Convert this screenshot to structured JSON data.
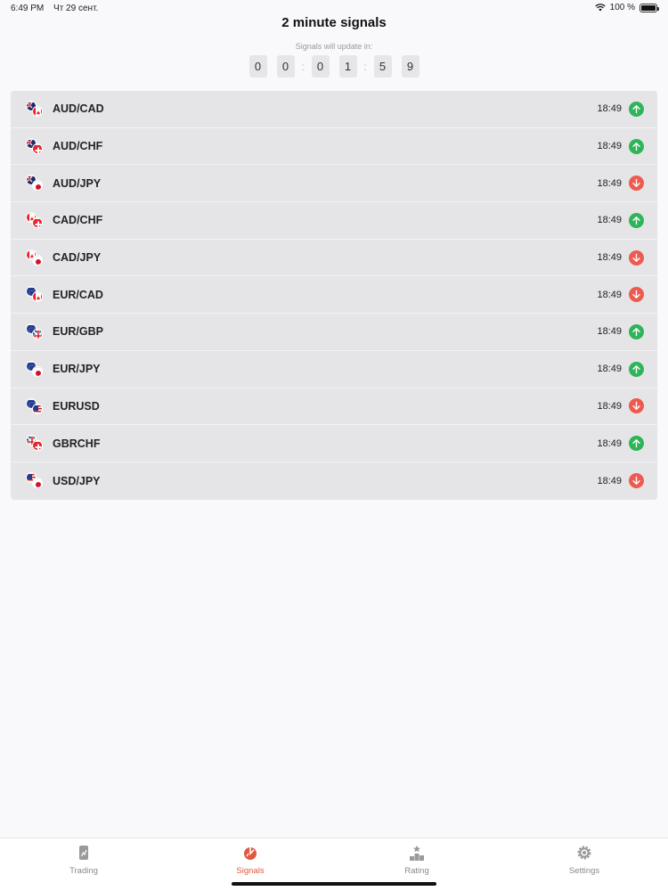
{
  "status_bar": {
    "time": "6:49 PM",
    "date": "Чт 29 сент.",
    "battery": "100 %"
  },
  "header": {
    "title": "2 minute signals",
    "countdown_label": "Signals will update in:",
    "countdown_digits": [
      "0",
      "0",
      "0",
      "1",
      "5",
      "9"
    ]
  },
  "signals": [
    {
      "pair": "AUD/CAD",
      "time": "18:49",
      "direction": "up",
      "flags": [
        "au",
        "ca"
      ]
    },
    {
      "pair": "AUD/CHF",
      "time": "18:49",
      "direction": "up",
      "flags": [
        "au",
        "ch"
      ]
    },
    {
      "pair": "AUD/JPY",
      "time": "18:49",
      "direction": "down",
      "flags": [
        "au",
        "jp"
      ]
    },
    {
      "pair": "CAD/CHF",
      "time": "18:49",
      "direction": "up",
      "flags": [
        "ca",
        "ch"
      ]
    },
    {
      "pair": "CAD/JPY",
      "time": "18:49",
      "direction": "down",
      "flags": [
        "ca",
        "jp"
      ]
    },
    {
      "pair": "EUR/CAD",
      "time": "18:49",
      "direction": "down",
      "flags": [
        "eu",
        "ca"
      ]
    },
    {
      "pair": "EUR/GBP",
      "time": "18:49",
      "direction": "up",
      "flags": [
        "eu",
        "gb"
      ]
    },
    {
      "pair": "EUR/JPY",
      "time": "18:49",
      "direction": "up",
      "flags": [
        "eu",
        "jp"
      ]
    },
    {
      "pair": "EURUSD",
      "time": "18:49",
      "direction": "down",
      "flags": [
        "eu",
        "us"
      ]
    },
    {
      "pair": "GBRCHF",
      "time": "18:49",
      "direction": "up",
      "flags": [
        "gb",
        "ch"
      ]
    },
    {
      "pair": "USD/JPY",
      "time": "18:49",
      "direction": "down",
      "flags": [
        "us",
        "jp"
      ]
    }
  ],
  "tabs": [
    {
      "label": "Trading",
      "icon": "trading-icon",
      "active": false
    },
    {
      "label": "Signals",
      "icon": "signals-icon",
      "active": true
    },
    {
      "label": "Rating",
      "icon": "rating-icon",
      "active": false
    },
    {
      "label": "Settings",
      "icon": "gear-icon",
      "active": false
    }
  ],
  "colors": {
    "up": "#2fb45a",
    "down": "#ee5a4f",
    "active_tab": "#e4573d",
    "inactive_tab": "#8a8a8a",
    "row_bg": "#e5e5e7"
  }
}
